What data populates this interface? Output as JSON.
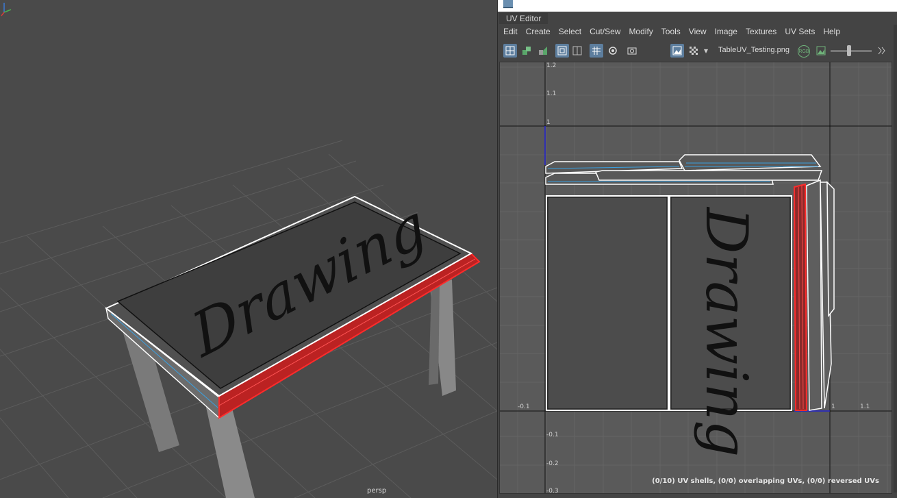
{
  "viewport": {
    "camera_label": "persp",
    "texture_text": "Drawing",
    "axis_labels": [
      "Z",
      "Y",
      "X"
    ],
    "colors": {
      "selection": "#e02020",
      "wireframe": "#ffffff",
      "background": "#4a4a4a"
    }
  },
  "uv_editor": {
    "panel_title": "UV Editor",
    "menus": [
      "Edit",
      "Create",
      "Select",
      "Cut/Sew",
      "Modify",
      "Tools",
      "View",
      "Image",
      "Textures",
      "UV Sets",
      "Help"
    ],
    "toolbar_icons": [
      "uv-grid-icon",
      "shell-icon",
      "stack-icon",
      "grid-display-icon",
      "frame-icon",
      "checker-grid-icon",
      "pivot-icon",
      "snapshot-icon",
      "image-display-icon",
      "checker-icon",
      "dropdown-arrow-icon",
      "rgb-icon",
      "image-icon",
      "next-icon"
    ],
    "image_name": "TableUV_Testing.png",
    "rgb_label": "RGB",
    "zoom_level": 0.5,
    "tick_labels": {
      "v": [
        "1.2",
        "1.1",
        "1",
        "-0.1",
        "-0.2",
        "-0.3"
      ],
      "u": [
        "-0.1",
        "1",
        "1.1"
      ]
    },
    "status": "(0/10) UV shells, (0/0) overlapping UVs, (0/0) reversed UVs"
  }
}
